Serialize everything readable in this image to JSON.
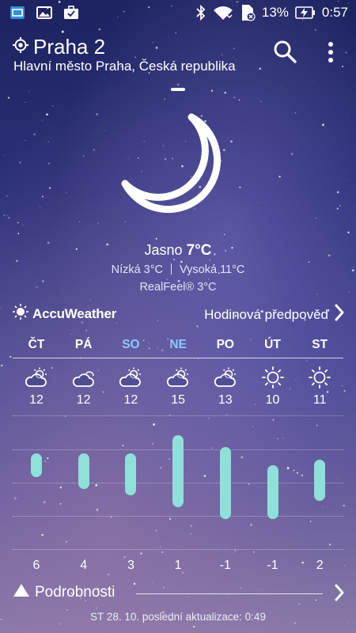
{
  "status_bar": {
    "battery_percent": "13%",
    "time": "0:57",
    "left_icons": [
      "screen-cast-icon",
      "image-icon",
      "briefcase-icon"
    ],
    "right_icons": [
      "bluetooth-icon",
      "wifi-icon",
      "sim-no-signal-icon",
      "battery-charging-icon"
    ]
  },
  "header": {
    "city": "Praha 2",
    "region": "Hlavní město Praha, Česká republika"
  },
  "current": {
    "condition": "Jasno",
    "temp": "7°C",
    "low": "Nízká 3°C",
    "high": "Vysoká 11°C",
    "realfeel": "RealFeel® 3°C",
    "icon": "moon-icon"
  },
  "provider": {
    "name": "AccuWeather",
    "hourly_link": "Hodinová předpověď"
  },
  "forecast": {
    "days": [
      {
        "name": "ČT",
        "hi": "12",
        "lo": "6",
        "icon": "partly-cloudy-icon",
        "weekend": false
      },
      {
        "name": "PÁ",
        "hi": "12",
        "lo": "4",
        "icon": "cloudy-icon",
        "weekend": false
      },
      {
        "name": "SO",
        "hi": "12",
        "lo": "3",
        "icon": "partly-cloudy-icon",
        "weekend": true
      },
      {
        "name": "NE",
        "hi": "15",
        "lo": "1",
        "icon": "partly-cloudy-icon",
        "weekend": true
      },
      {
        "name": "PO",
        "hi": "13",
        "lo": "-1",
        "icon": "partly-cloudy-icon",
        "weekend": false
      },
      {
        "name": "ÚT",
        "hi": "10",
        "lo": "-1",
        "icon": "sunny-icon",
        "weekend": false
      },
      {
        "name": "ST",
        "hi": "11",
        "lo": "2",
        "icon": "sunny-icon",
        "weekend": false
      }
    ],
    "colors": {
      "bar": "#8ee0d9",
      "weekend": "#8fc8ff"
    }
  },
  "footer": {
    "details_label": "Podrobnosti",
    "updated": "ST 28. 10. poslední aktualizace: 0:49"
  }
}
